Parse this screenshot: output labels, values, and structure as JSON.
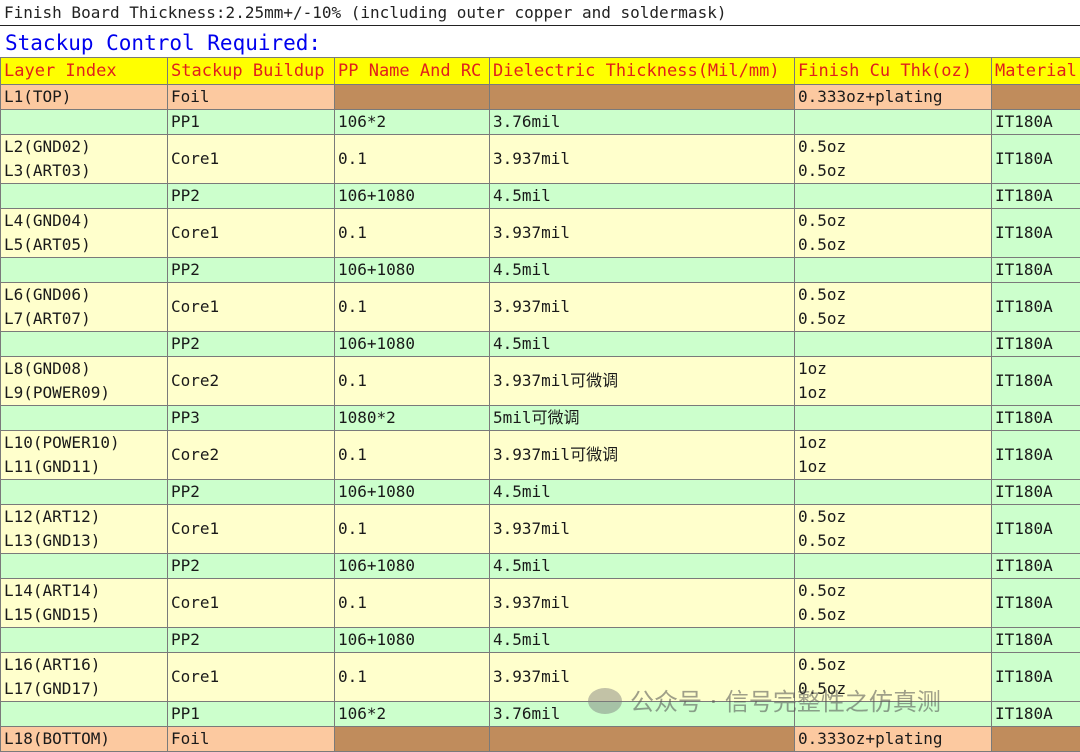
{
  "note": "Finish Board Thickness:2.25mm+/-10% (including outer copper and soldermask)",
  "heading": "Stackup Control Required:",
  "headers": [
    "Layer Index",
    "Stackup Buildup",
    "PP Name And RC",
    "Dielectric Thickness(Mil/mm)",
    "Finish Cu Thk(oz)",
    "Material"
  ],
  "foil_top": {
    "layer": "L1(TOP)",
    "buildup": "Foil",
    "name": "",
    "thk": "",
    "cu": "0.333oz+plating"
  },
  "foil_bottom": {
    "layer": "L18(BOTTOM)",
    "buildup": "Foil",
    "name": "",
    "thk": "",
    "cu": "0.333oz+plating"
  },
  "rows": [
    {
      "type": "pp",
      "buildup": "PP1",
      "name": "106*2",
      "thk": "3.76mil",
      "material": "IT180A"
    },
    {
      "type": "core",
      "layers": [
        "L2(GND02)",
        "L3(ART03)"
      ],
      "buildup": "Core1",
      "name": "0.1",
      "thk": "3.937mil",
      "cu": [
        "0.5oz",
        "0.5oz"
      ],
      "material": "IT180A"
    },
    {
      "type": "pp",
      "buildup": "PP2",
      "name": "106+1080",
      "thk": "4.5mil",
      "material": "IT180A"
    },
    {
      "type": "core",
      "layers": [
        "L4(GND04)",
        "L5(ART05)"
      ],
      "buildup": "Core1",
      "name": "0.1",
      "thk": "3.937mil",
      "cu": [
        "0.5oz",
        "0.5oz"
      ],
      "material": "IT180A"
    },
    {
      "type": "pp",
      "buildup": "PP2",
      "name": "106+1080",
      "thk": "4.5mil",
      "material": "IT180A"
    },
    {
      "type": "core",
      "layers": [
        "L6(GND06)",
        "L7(ART07)"
      ],
      "buildup": "Core1",
      "name": "0.1",
      "thk": "3.937mil",
      "cu": [
        "0.5oz",
        "0.5oz"
      ],
      "material": "IT180A"
    },
    {
      "type": "pp",
      "buildup": "PP2",
      "name": "106+1080",
      "thk": "4.5mil",
      "material": "IT180A"
    },
    {
      "type": "core",
      "layers": [
        "L8(GND08)",
        "L9(POWER09)"
      ],
      "buildup": "Core2",
      "name": "0.1",
      "thk": "3.937mil可微调",
      "cu": [
        "1oz",
        "1oz"
      ],
      "material": "IT180A"
    },
    {
      "type": "pp",
      "buildup": "PP3",
      "name": "1080*2",
      "thk": "5mil可微调",
      "material": "IT180A"
    },
    {
      "type": "core",
      "layers": [
        "L10(POWER10)",
        "L11(GND11)"
      ],
      "buildup": "Core2",
      "name": "0.1",
      "thk": "3.937mil可微调",
      "cu": [
        "1oz",
        "1oz"
      ],
      "material": "IT180A"
    },
    {
      "type": "pp",
      "buildup": "PP2",
      "name": "106+1080",
      "thk": "4.5mil",
      "material": "IT180A"
    },
    {
      "type": "core",
      "layers": [
        "L12(ART12)",
        "L13(GND13)"
      ],
      "buildup": "Core1",
      "name": "0.1",
      "thk": "3.937mil",
      "cu": [
        "0.5oz",
        "0.5oz"
      ],
      "material": "IT180A"
    },
    {
      "type": "pp",
      "buildup": "PP2",
      "name": "106+1080",
      "thk": "4.5mil",
      "material": "IT180A"
    },
    {
      "type": "core",
      "layers": [
        "L14(ART14)",
        "L15(GND15)"
      ],
      "buildup": "Core1",
      "name": "0.1",
      "thk": "3.937mil",
      "cu": [
        "0.5oz",
        "0.5oz"
      ],
      "material": "IT180A"
    },
    {
      "type": "pp",
      "buildup": "PP2",
      "name": "106+1080",
      "thk": "4.5mil",
      "material": "IT180A"
    },
    {
      "type": "core",
      "layers": [
        "L16(ART16)",
        "L17(GND17)"
      ],
      "buildup": "Core1",
      "name": "0.1",
      "thk": "3.937mil",
      "cu": [
        "0.5oz",
        "0.5oz"
      ],
      "material": "IT180A"
    },
    {
      "type": "pp",
      "buildup": "PP1",
      "name": "106*2",
      "thk": "3.76mil",
      "material": "IT180A"
    }
  ],
  "watermark": "公众号 · 信号完整性之仿真测"
}
